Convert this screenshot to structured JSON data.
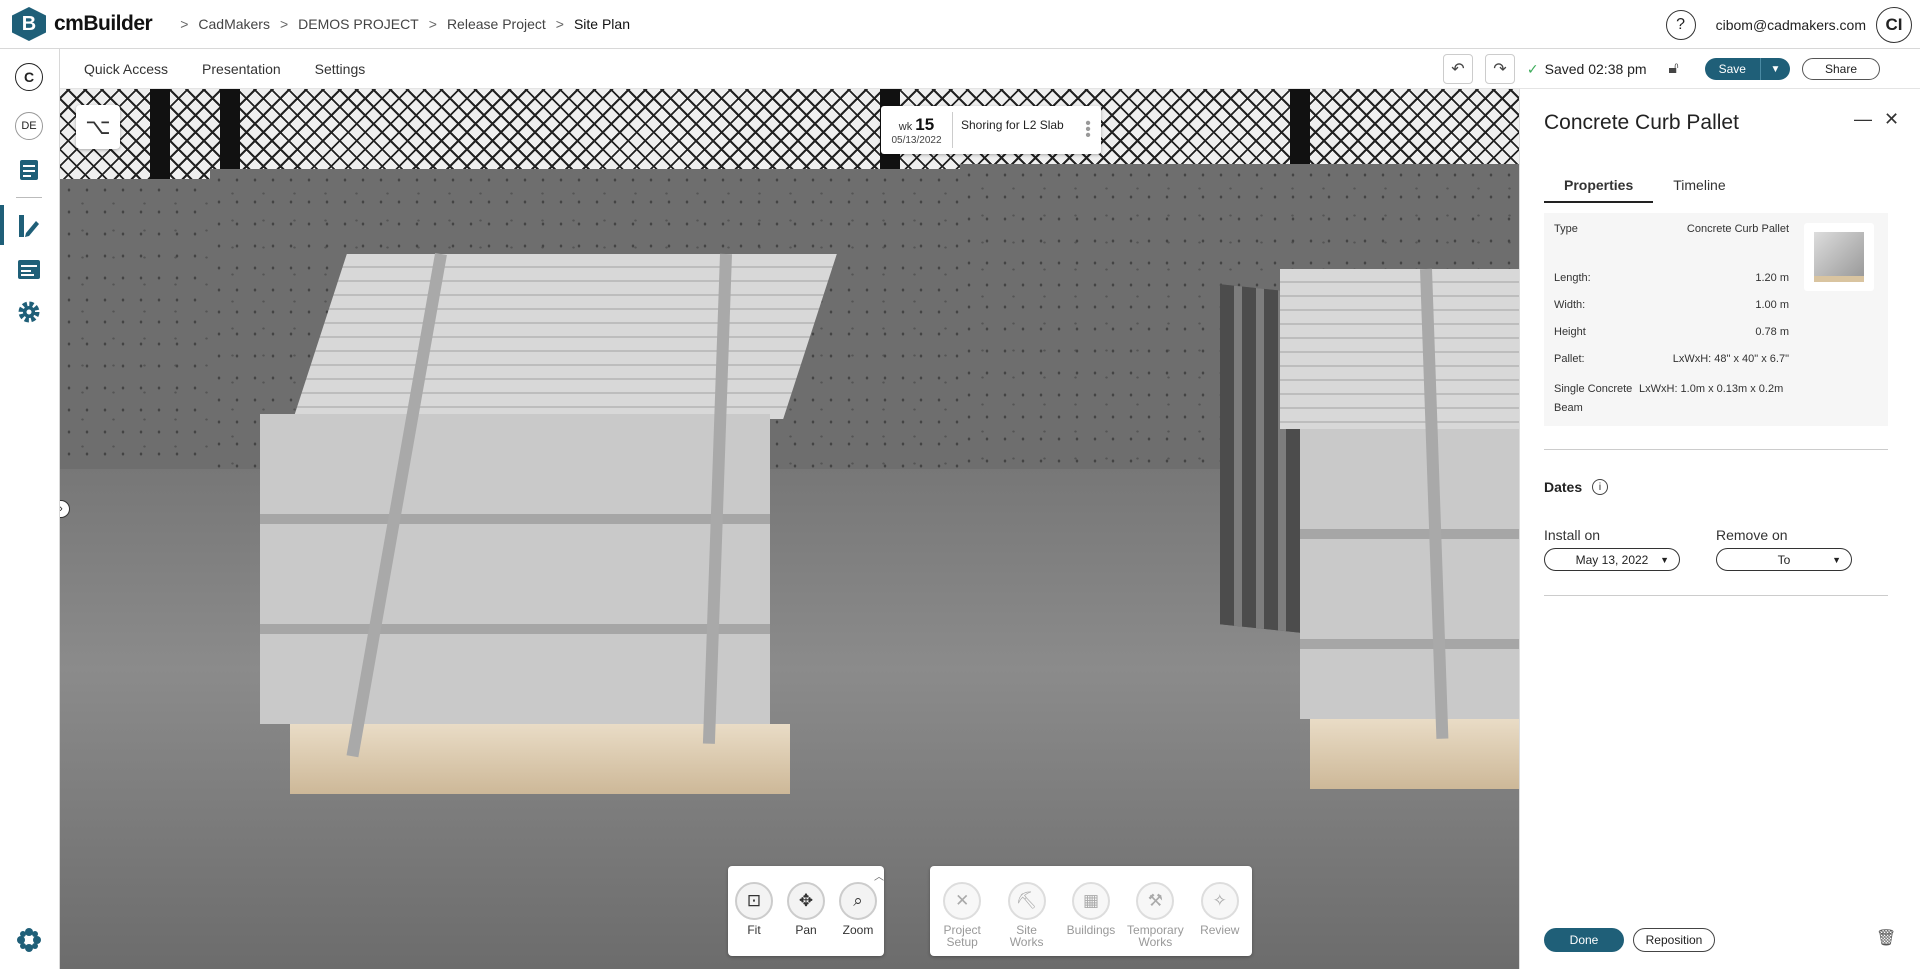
{
  "app": {
    "name": "cmBuilder",
    "logo_letter": "B"
  },
  "breadcrumb": [
    "CadMakers",
    "DEMOS PROJECT",
    "Release Project",
    "Site Plan"
  ],
  "user": {
    "email": "cibom@cadmakers.com",
    "initials": "CI"
  },
  "leftrail": {
    "org_initial": "C",
    "user_short": "DE"
  },
  "menu": [
    "Quick Access",
    "Presentation",
    "Settings"
  ],
  "status": {
    "saved": "Saved 02:38 pm"
  },
  "toolbar": {
    "save": "Save",
    "share": "Share"
  },
  "week_card": {
    "wk_label": "wk",
    "wk_number": "15",
    "date": "05/13/2022",
    "task": "Shoring for L2 Slab"
  },
  "nav_tools": [
    {
      "label": "Fit"
    },
    {
      "label": "Pan"
    },
    {
      "label": "Zoom"
    }
  ],
  "work_tools": [
    {
      "label": "Project Setup"
    },
    {
      "label": "Site Works"
    },
    {
      "label": "Buildings"
    },
    {
      "label": "Temporary Works"
    },
    {
      "label": "Review"
    }
  ],
  "panel": {
    "title": "Concrete Curb Pallet",
    "tabs": [
      "Properties",
      "Timeline"
    ],
    "properties": [
      {
        "label": "Type",
        "value": "Concrete Curb Pallet"
      },
      {
        "label": "Length:",
        "value": "1.20 m"
      },
      {
        "label": "Width:",
        "value": "1.00 m"
      },
      {
        "label": "Height",
        "value": "0.78 m"
      },
      {
        "label": "Pallet:",
        "value": "LxWxH: 48\" x 40\" x 6.7\""
      },
      {
        "label": "Single Concrete Beam",
        "value": "LxWxH: 1.0m x 0.13m x 0.2m"
      }
    ],
    "dates_title": "Dates",
    "install_label": "Install on",
    "install_value": "May 13, 2022",
    "remove_label": "Remove on",
    "remove_value": "To",
    "done": "Done",
    "reposition": "Reposition"
  }
}
